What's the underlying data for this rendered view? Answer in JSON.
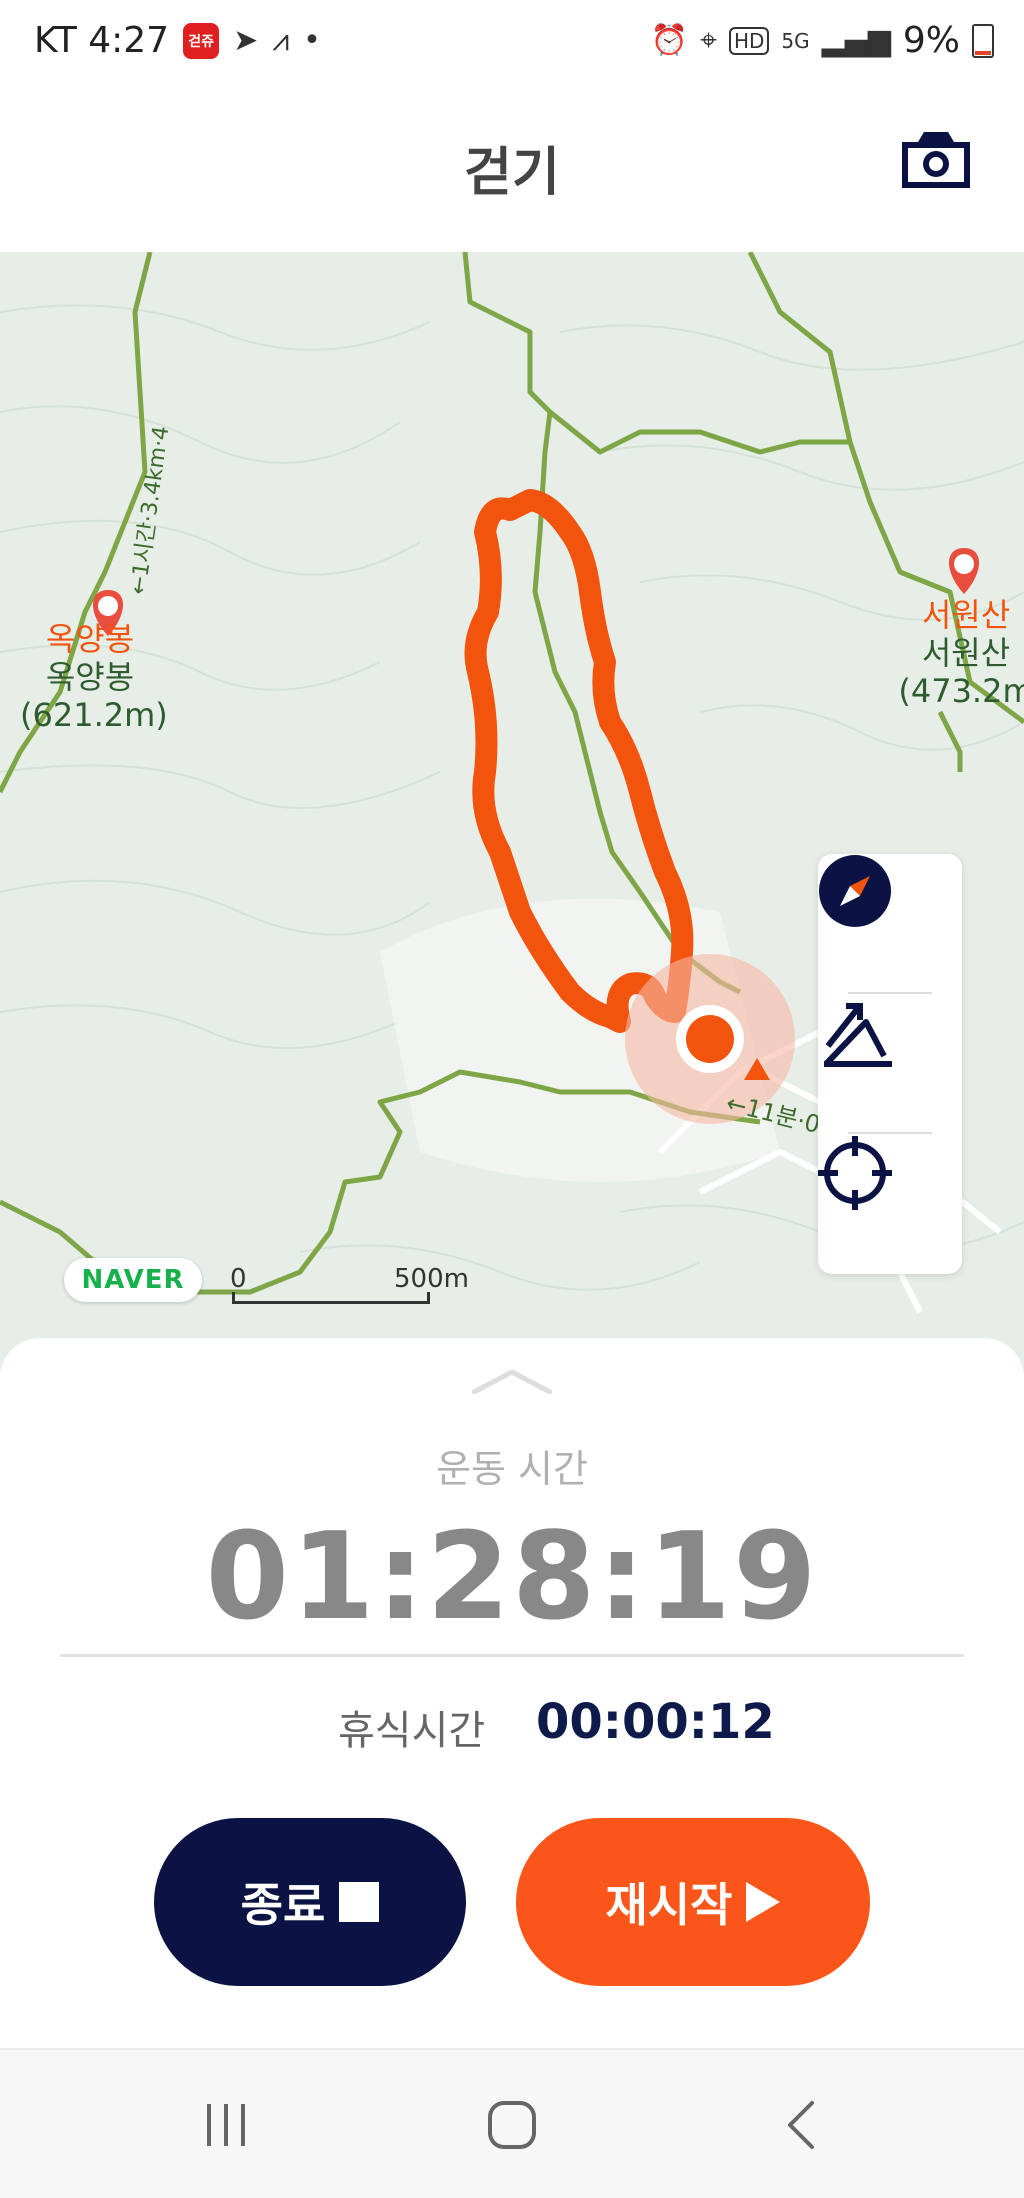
{
  "status_bar": {
    "carrier_time": "KT 4:27",
    "app_badge": "걷쥬",
    "dot": "•",
    "battery": "9%"
  },
  "header": {
    "title": "걷기"
  },
  "map": {
    "peaks": [
      {
        "name": "옥양봉",
        "label_secondary": "옥양봉",
        "height": "(621.2m)"
      },
      {
        "name": "서원산",
        "label_secondary": "서원산",
        "height": "(473.2m"
      }
    ],
    "trail_label_left": "←1시간·3.4km·4",
    "trail_label_right": "←11분·0",
    "provider": "NAVER",
    "scale_start": "0",
    "scale_end": "500m"
  },
  "panel": {
    "exercise_time_label": "운동 시간",
    "exercise_time": "01:28:19",
    "rest_time_label": "휴식시간",
    "rest_time": "00:00:12",
    "end_button_label": "종료",
    "restart_button_label": "재시작"
  },
  "colors": {
    "accent_orange": "#fb561a",
    "navy": "#0a1344",
    "trail_green": "#7ea646",
    "map_bg": "#e7eee7"
  },
  "icons": {
    "camera": "camera-icon",
    "compass": "compass-icon",
    "elevation": "elevation-icon",
    "locate": "crosshair-icon"
  }
}
